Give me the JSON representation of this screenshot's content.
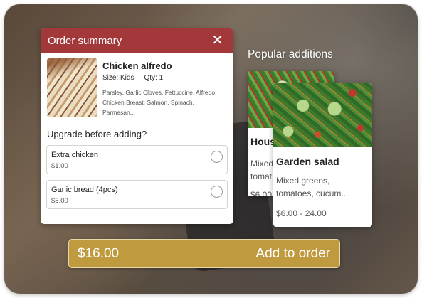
{
  "order_summary": {
    "title": "Order summary",
    "close_glyph": "✕",
    "item": {
      "name": "Chicken alfredo",
      "size": "Size: Kids",
      "qty": "Qty: 1",
      "ingredients": "Parsley, Garlic Cloves, Fettuccine, Alfredo, Chicken Breast, Salmon, Spinach, Parmesan..."
    },
    "upgrade_title": "Upgrade before adding?",
    "options": [
      {
        "label": "Extra chicken",
        "price": "$1.00"
      },
      {
        "label": "Garlic bread (4pcs)",
        "price": "$5.00"
      }
    ]
  },
  "popular": {
    "title": "Popular additions",
    "cards": [
      {
        "name": "Hous",
        "desc_lines": [
          "Mixed",
          "tomat"
        ],
        "price": "$6.00"
      },
      {
        "name": "Garden salad",
        "desc": "Mixed greens, tomatoes, cucum...",
        "price": "$6.00 - 24.00"
      }
    ]
  },
  "footer": {
    "total": "$16.00",
    "add_label": "Add to order"
  },
  "colors": {
    "header_red": "#a3383a",
    "add_bar_gold": "#bf9a3e"
  },
  "icons": [
    "close-icon",
    "radio-icon"
  ]
}
